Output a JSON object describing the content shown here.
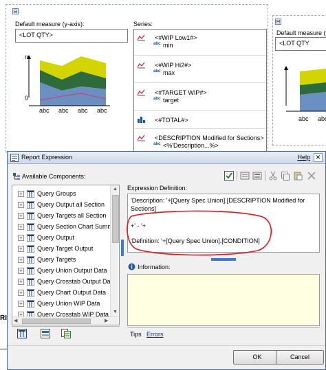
{
  "report": {
    "collapse_symbol": "⊟",
    "left_chart": {
      "default_measure_label": "Default measure (y-axis):",
      "default_measure_value": "<LOT QTY>",
      "axis_n": "n",
      "axis_zero": "0",
      "x_labels": [
        "abc",
        "abc",
        "abc",
        "abc"
      ]
    },
    "series_panel": {
      "title": "Series:",
      "items": [
        {
          "name": "<#WIP Low1#>",
          "value": "min",
          "icon": "line-series-icon"
        },
        {
          "name": "<#WIP Hi2#>",
          "value": "max",
          "icon": "line-series-icon"
        },
        {
          "name": "<#TARGET WIP#>",
          "value": "target",
          "icon": "line-series-icon"
        },
        {
          "name": "<#TOTAL#>",
          "value": "",
          "icon": "bar-series-icon"
        },
        {
          "name": "<DESCRIPTION Modified for Sections>",
          "value": "<%'Description...%>",
          "icon": "line-series-icon"
        }
      ]
    },
    "right_chart": {
      "default_measure_label": "Default measure (y-axis",
      "default_measure_value": "<LOT QTY",
      "x_labels": [
        "abc",
        "abc"
      ]
    },
    "left_edge_text": "RI"
  },
  "dialog": {
    "title": "Report Expression",
    "help": "Help",
    "close": "✕",
    "available_components_label": "Available Components:",
    "tree_items": [
      "Query Groups",
      "Query Output all Section",
      "Query Targets all Section",
      "Query Section Chart Summa",
      "Query Output",
      "Query Target Output",
      "Query Targets",
      "Query Union Output Data",
      "Query Crosstab Output Dat",
      "Query Chart Output Data",
      "Query Union WIP Data",
      "Query Crosstab WIP Data"
    ],
    "expression_label": "Expression Definition:",
    "expression_lines": [
      "'Description: '+[Query Spec Union].[DESCRIPTION Modified for",
      "Sections]",
      "+' - '+",
      "'Definition: '+[Query Spec Union].[CONDITION]"
    ],
    "information_label": "Information:",
    "tabs": [
      "Tips",
      "Errors"
    ],
    "ok": "OK",
    "cancel": "Cancel"
  },
  "colors": {
    "area_yellow": "#d4d400",
    "area_green": "#2e6b3a",
    "area_blue": "#6a8fc0",
    "annotation_red": "#e0141e",
    "info_bg": "#ffffe1"
  }
}
